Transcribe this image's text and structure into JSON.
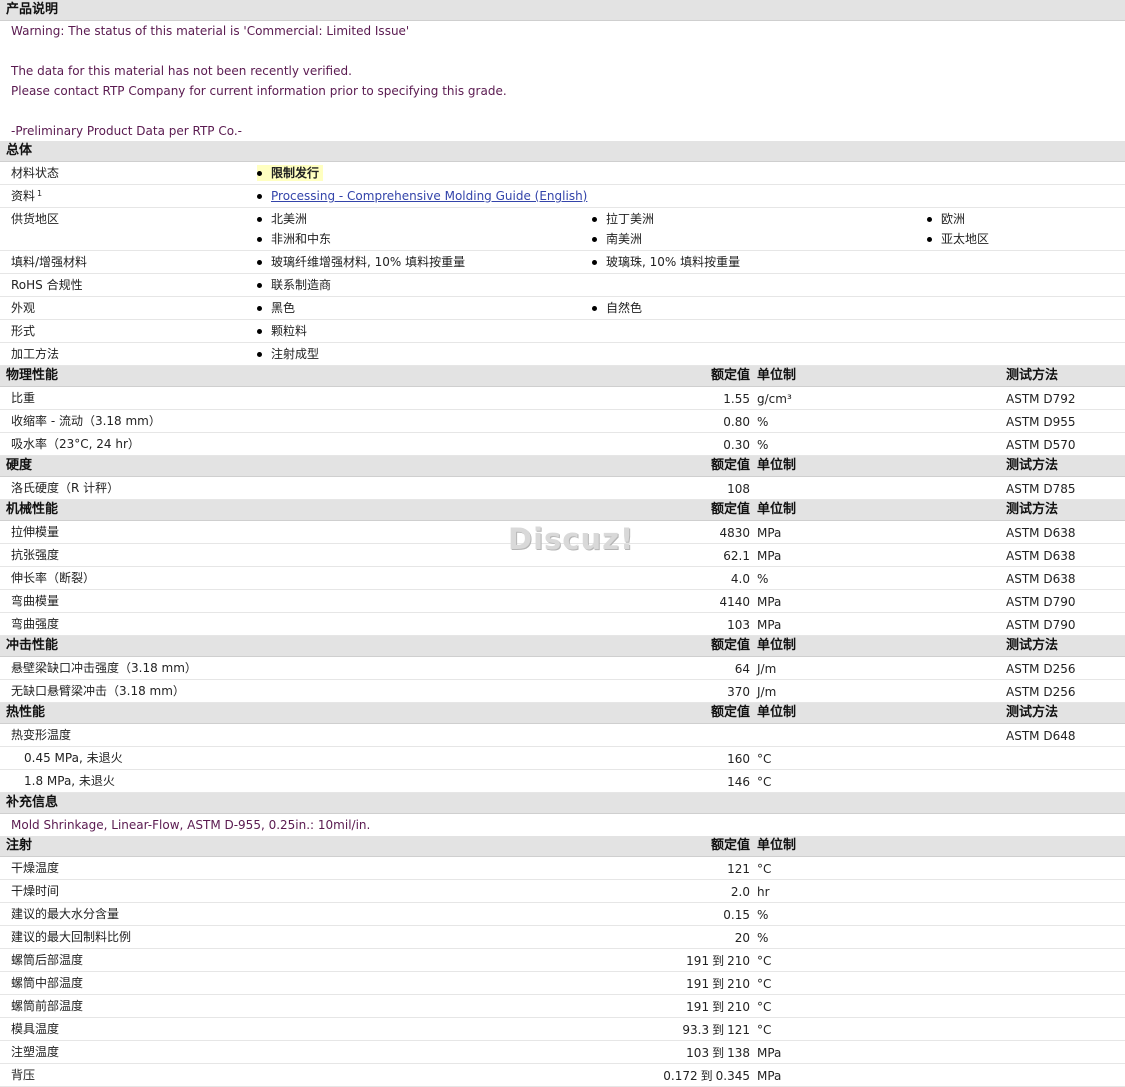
{
  "sections": {
    "desc": "产品说明",
    "general": "总体",
    "physical": "物理性能",
    "hardness": "硬度",
    "mechanical": "机械性能",
    "impact": "冲击性能",
    "thermal": "热性能",
    "supplement": "补充信息",
    "injection": "注射"
  },
  "headers": {
    "value": "额定值",
    "unit": "单位制",
    "method": "测试方法"
  },
  "desc": {
    "l1": "Warning: The status of this material is 'Commercial: Limited Issue'",
    "l2": "The data for this material has not been recently verified.",
    "l3": "Please contact RTP Company for current information prior to specifying this grade.",
    "l4": "-Preliminary Product Data per RTP Co.-"
  },
  "general": {
    "status_label": "材料状态",
    "status": "限制发行",
    "docs_label": "资料",
    "docs_sup": "1",
    "docs_link": "Processing - Comprehensive Molding Guide (English)",
    "region_label": "供货地区",
    "regions": [
      "北美洲",
      "拉丁美洲",
      "欧洲",
      "非洲和中东",
      "南美洲",
      "亚太地区"
    ],
    "filler_label": "填料/增强材料",
    "fillers": [
      "玻璃纤维增强材料, 10% 填料按重量",
      "玻璃珠, 10% 填料按重量"
    ],
    "rohs_label": "RoHS 合规性",
    "rohs": "联系制造商",
    "appearance_label": "外观",
    "appearance": [
      "黑色",
      "自然色"
    ],
    "form_label": "形式",
    "form": "颗粒料",
    "process_label": "加工方法",
    "process": "注射成型"
  },
  "physical": [
    {
      "label": "比重",
      "value": "1.55",
      "unit": "g/cm³",
      "method": "ASTM D792"
    },
    {
      "label": "收缩率  - 流动（3.18 mm）",
      "value": "0.80",
      "unit": "%",
      "method": "ASTM D955"
    },
    {
      "label": "吸水率（23°C, 24 hr）",
      "value": "0.30",
      "unit": "%",
      "method": "ASTM D570"
    }
  ],
  "hardness": [
    {
      "label": "洛氏硬度（R 计秤）",
      "value": "108",
      "unit": "",
      "method": "ASTM D785"
    }
  ],
  "mechanical": [
    {
      "label": "拉伸模量",
      "value": "4830",
      "unit": "MPa",
      "method": "ASTM D638"
    },
    {
      "label": "抗张强度",
      "value": "62.1",
      "unit": "MPa",
      "method": "ASTM D638"
    },
    {
      "label": "伸长率（断裂）",
      "value": "4.0",
      "unit": "%",
      "method": "ASTM D638"
    },
    {
      "label": "弯曲模量",
      "value": "4140",
      "unit": "MPa",
      "method": "ASTM D790"
    },
    {
      "label": "弯曲强度",
      "value": "103",
      "unit": "MPa",
      "method": "ASTM D790"
    }
  ],
  "impact": [
    {
      "label": "悬壁梁缺口冲击强度（3.18 mm）",
      "value": "64",
      "unit": "J/m",
      "method": "ASTM D256"
    },
    {
      "label": "无缺口悬臂梁冲击（3.18 mm）",
      "value": "370",
      "unit": "J/m",
      "method": "ASTM D256"
    }
  ],
  "thermal": {
    "label": "热变形温度",
    "method": "ASTM D648",
    "sub": [
      {
        "label": "0.45 MPa, 未退火",
        "value": "160",
        "unit": "°C"
      },
      {
        "label": "1.8 MPa, 未退火",
        "value": "146",
        "unit": "°C"
      }
    ]
  },
  "supplement": {
    "text": "Mold Shrinkage, Linear-Flow, ASTM D-955, 0.25in.: 10mil/in."
  },
  "injection": [
    {
      "label": "干燥温度",
      "value": "121",
      "unit": "°C"
    },
    {
      "label": "干燥时间",
      "value": "2.0",
      "unit": "hr"
    },
    {
      "label": "建议的最大水分含量",
      "value": "0.15",
      "unit": "%"
    },
    {
      "label": "建议的最大回制料比例",
      "value": "20",
      "unit": "%"
    },
    {
      "label": "螺筒后部温度",
      "from": "191",
      "sep": "到",
      "to": "210",
      "unit": "°C"
    },
    {
      "label": "螺筒中部温度",
      "from": "191",
      "sep": "到",
      "to": "210",
      "unit": "°C"
    },
    {
      "label": "螺筒前部温度",
      "from": "191",
      "sep": "到",
      "to": "210",
      "unit": "°C"
    },
    {
      "label": "模具温度",
      "from": "93.3",
      "sep": "到",
      "to": "121",
      "unit": "°C"
    },
    {
      "label": "注塑温度",
      "from": "103",
      "sep": "到",
      "to": "138",
      "unit": "MPa"
    },
    {
      "label": "背压",
      "from": "0.172",
      "sep": "到",
      "to": "0.345",
      "unit": "MPa"
    }
  ],
  "watermark": "Discuz!"
}
